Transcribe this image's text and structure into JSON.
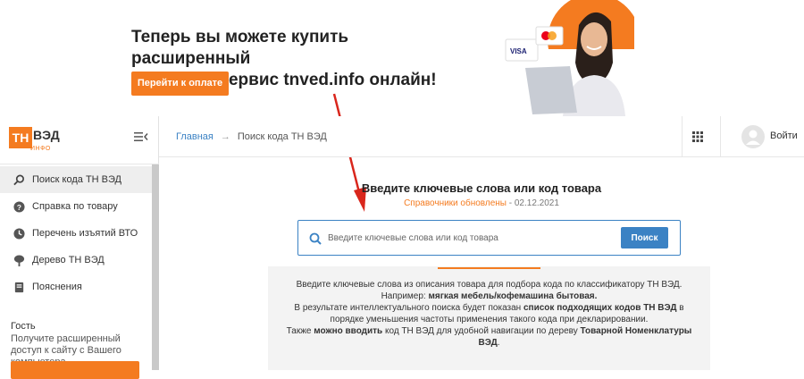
{
  "promo": {
    "title_line1": "Теперь вы можете купить расширенный",
    "title_line2": "доступ на сервис tnved.info онлайн!",
    "button_label": "Перейти к оплате",
    "card_visa": "VISA"
  },
  "logo": {
    "th": "ТН",
    "ved": "ВЭД",
    "info": "ИНФО"
  },
  "sidebar": {
    "items": [
      {
        "label": "Поиск кода ТН ВЭД",
        "icon": "search-icon",
        "active": true
      },
      {
        "label": "Справка по товару",
        "icon": "help-icon",
        "active": false
      },
      {
        "label": "Перечень изъятий ВТО",
        "icon": "clock-icon",
        "active": false
      },
      {
        "label": "Дерево ТН ВЭД",
        "icon": "tree-icon",
        "active": false
      },
      {
        "label": "Пояснения",
        "icon": "book-icon",
        "active": false
      }
    ],
    "guest_title": "Гость",
    "guest_desc": "Получите расширенный доступ к сайту с Вашего компьютера"
  },
  "topbar": {
    "breadcrumb_home": "Главная",
    "breadcrumb_arrow": "→",
    "breadcrumb_current": "Поиск кода ТН ВЭД",
    "login_label": "Войти"
  },
  "main": {
    "title": "Введите ключевые слова или код товара",
    "update_link": "Справочники обновлены",
    "update_sep": " - ",
    "update_date": "02.12.2021",
    "search_placeholder": "Введите ключевые слова или код товара",
    "search_value": "",
    "search_button": "Поиск"
  },
  "help": {
    "line1": "Введите ключевые слова из описания товара для подбора кода по классификатору ТН ВЭД.",
    "line2_prefix": "Например: ",
    "line2_bold": "мягкая мебель/кофемашина бытовая.",
    "line3_prefix": "В результате интеллектуального поиска будет показан ",
    "line3_bold": "список подходящих кодов ТН ВЭД",
    "line3_suffix": " в порядке уменьшения частоты применения такого кода при декларировании.",
    "line4_prefix": "Также ",
    "line4_bold1": "можно вводить",
    "line4_mid": " код ТН ВЭД для удобной навигации по дереву ",
    "line4_bold2": "Товарной Номенклатуры ВЭД",
    "line4_suffix": "."
  },
  "colors": {
    "accent": "#f47b20",
    "link": "#3b82c4",
    "annotation_arrow": "#d9261c"
  }
}
